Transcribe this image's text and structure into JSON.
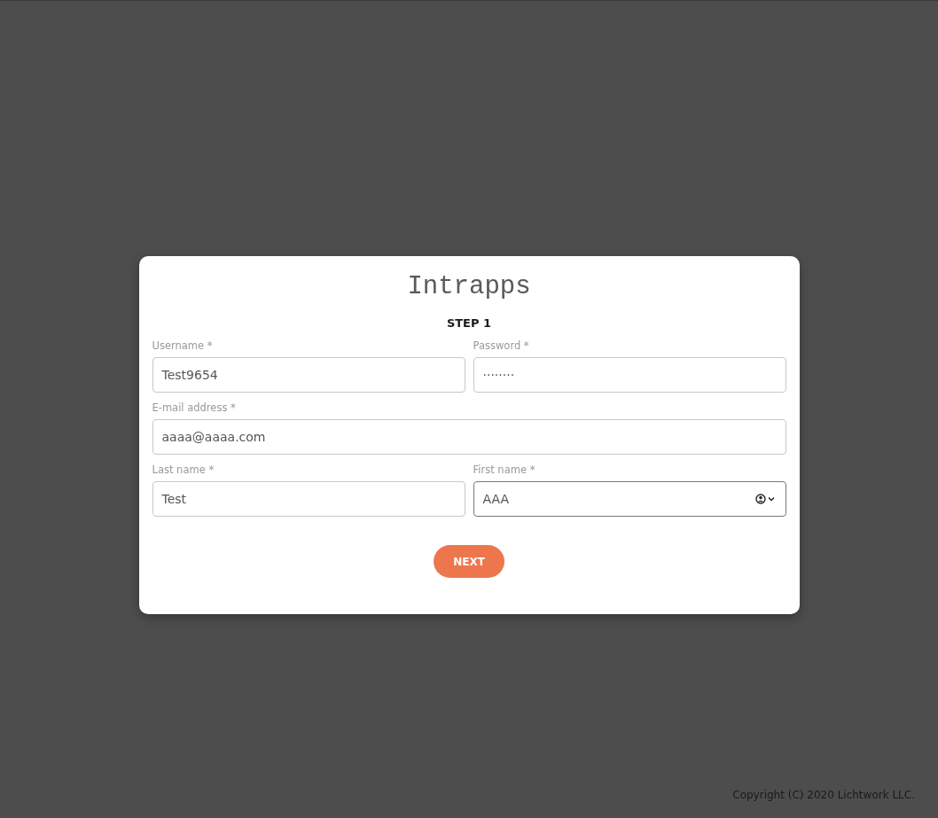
{
  "app_title": "Intrapps",
  "step": "STEP 1",
  "rows": [
    [
      {
        "label": "Username *",
        "value": "Test9654",
        "focused": false
      },
      {
        "label": "Password *",
        "value": "········",
        "focused": false
      }
    ],
    [
      {
        "label": "E-mail address *",
        "value": "aaaa@aaaa.com",
        "focused": false
      }
    ],
    [
      {
        "label": "Last name *",
        "value": "Test",
        "focused": false
      },
      {
        "label": "First name *",
        "value": "AAA",
        "focused": true
      }
    ]
  ],
  "next_button": "NEXT",
  "footer": "Copyright (C) 2020 Lichtwork LLC."
}
